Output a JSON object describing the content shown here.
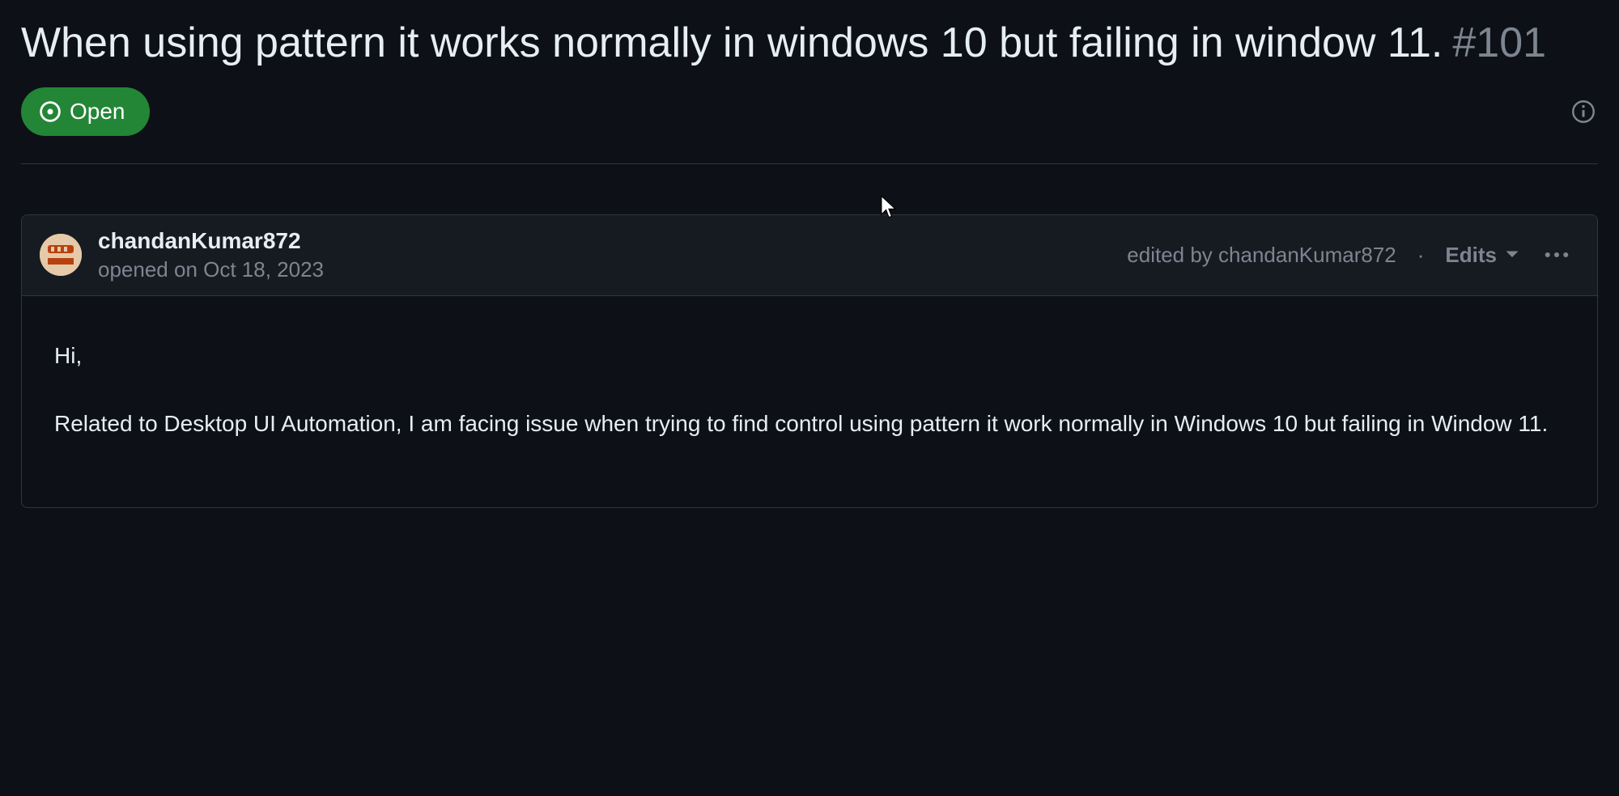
{
  "issue": {
    "title": "When using pattern it works normally in windows 10 but failing in window 11.",
    "number": "#101",
    "status": "Open"
  },
  "comment": {
    "author": "chandanKumar872",
    "opened": "opened on Oct 18, 2023",
    "edited_by": "edited by chandanKumar872",
    "edits_label": "Edits",
    "body": {
      "p1": "Hi,",
      "p2": "Related to Desktop UI Automation, I am facing issue when trying to find control using pattern it work normally in Windows 10 but failing in Window 11."
    }
  }
}
